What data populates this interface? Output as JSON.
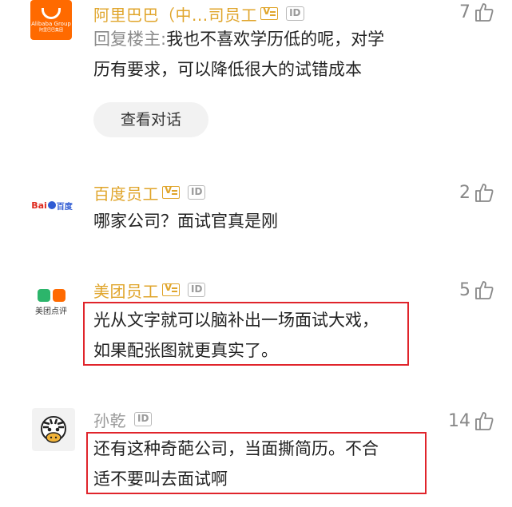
{
  "comments": [
    {
      "user": "阿里巴巴（中...司员工",
      "avatar": "alibaba-logo",
      "likes": "7",
      "reply_prefix": "回复楼主:",
      "text_line1": "我也不喜欢学历低的呢，对学",
      "text_line2": "历有要求，可以降低很大的试错成本",
      "action_label": "查看对话",
      "logo_word": "Alibaba",
      "logo_sub": "Group",
      "logo_cn": "阿里巴巴集团"
    },
    {
      "user": "百度员工",
      "avatar": "baidu-logo",
      "likes": "2",
      "text_line1": "哪家公司？面试官真是刚",
      "logo_word": "Bai",
      "logo_du": "百度"
    },
    {
      "user": "美团员工",
      "avatar": "meituan-logo",
      "likes": "5",
      "text_line1": "光从文字就可以脑补出一场面试大戏，",
      "text_line2": "如果配张图就更真实了。",
      "logo_word": "美团点评"
    },
    {
      "user": "孙乾",
      "avatar": "zebra-avatar",
      "likes": "14",
      "text_line1": "还有这种奇葩公司，当面撕简历。不合",
      "text_line2": "适不要叫去面试啊"
    }
  ],
  "id_badge_label": "ID",
  "colors": {
    "company_name": "#e0a52b",
    "highlight_box": "#e0242b",
    "pill_bg": "#f2f2f2"
  }
}
